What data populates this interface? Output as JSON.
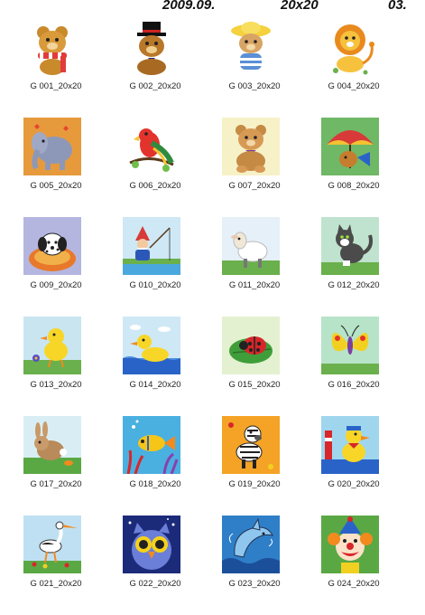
{
  "header": {
    "date": "2009.09.",
    "size": "20x20",
    "page": "03."
  },
  "items": [
    {
      "code": "G 001_20x20",
      "icon": "teddy-bear-scarf-icon",
      "bg": "#ffffff"
    },
    {
      "code": "G 002_20x20",
      "icon": "teddy-bear-tophat-icon",
      "bg": "#ffffff"
    },
    {
      "code": "G 003_20x20",
      "icon": "teddy-bear-sunhat-icon",
      "bg": "#ffffff"
    },
    {
      "code": "G 004_20x20",
      "icon": "lion-icon",
      "bg": "#ffffff"
    },
    {
      "code": "G 005_20x20",
      "icon": "elephant-icon",
      "bg": "#e79a3c"
    },
    {
      "code": "G 006_20x20",
      "icon": "parrot-icon",
      "bg": "#ffffff"
    },
    {
      "code": "G 007_20x20",
      "icon": "teddy-bear-sitting-icon",
      "bg": "#f7f1c8"
    },
    {
      "code": "G 008_20x20",
      "icon": "bear-umbrella-icon",
      "bg": "#6fb866"
    },
    {
      "code": "G 009_20x20",
      "icon": "dalmatian-icon",
      "bg": "#b4b6e0"
    },
    {
      "code": "G 010_20x20",
      "icon": "gnome-fishing-icon",
      "bg": "#cfe8f5"
    },
    {
      "code": "G 011_20x20",
      "icon": "lamb-icon",
      "bg": "#e6f0f8"
    },
    {
      "code": "G 012_20x20",
      "icon": "cat-icon",
      "bg": "#bfe3cf"
    },
    {
      "code": "G 013_20x20",
      "icon": "duckling-flower-icon",
      "bg": "#c9e5ef"
    },
    {
      "code": "G 014_20x20",
      "icon": "duck-water-icon",
      "bg": "#cfe8f5"
    },
    {
      "code": "G 015_20x20",
      "icon": "ladybug-icon",
      "bg": "#e3f1d0"
    },
    {
      "code": "G 016_20x20",
      "icon": "butterfly-icon",
      "bg": "#b7e3c8"
    },
    {
      "code": "G 017_20x20",
      "icon": "rabbit-icon",
      "bg": "#d9eef4"
    },
    {
      "code": "G 018_20x20",
      "icon": "fish-coral-icon",
      "bg": "#4ab0e0"
    },
    {
      "code": "G 019_20x20",
      "icon": "zebra-icon",
      "bg": "#f4a326"
    },
    {
      "code": "G 020_20x20",
      "icon": "duck-sailor-icon",
      "bg": "#9fd6ee"
    },
    {
      "code": "G 021_20x20",
      "icon": "stork-icon",
      "bg": "#bfe0f2"
    },
    {
      "code": "G 022_20x20",
      "icon": "owl-icon",
      "bg": "#1c2a7a"
    },
    {
      "code": "G 023_20x20",
      "icon": "dolphin-icon",
      "bg": "#2f7fc8"
    },
    {
      "code": "G 024_20x20",
      "icon": "clown-icon",
      "bg": "#5aa844"
    }
  ]
}
